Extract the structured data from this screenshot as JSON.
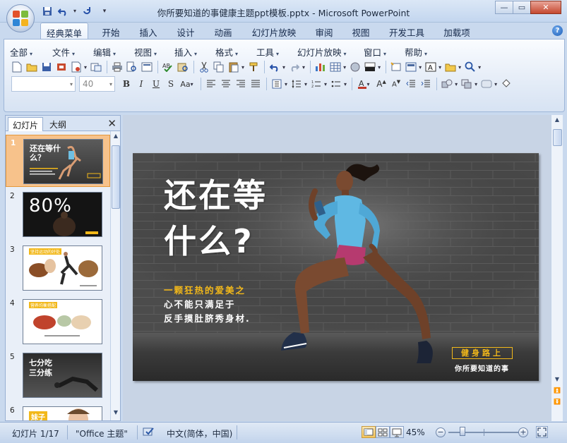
{
  "window": {
    "title": "你所要知道的事健康主题ppt模板.pptx - Microsoft PowerPoint"
  },
  "ribbon_tabs": [
    "经典菜单",
    "开始",
    "插入",
    "设计",
    "动画",
    "幻灯片放映",
    "审阅",
    "视图",
    "开发工具",
    "加载项"
  ],
  "classic_menu": [
    "全部",
    "文件",
    "编辑",
    "视图",
    "插入",
    "格式",
    "工具",
    "幻灯片放映",
    "窗口",
    "帮助"
  ],
  "font_size": "40",
  "panel": {
    "tabs": [
      "幻灯片",
      "大纲"
    ],
    "thumbnails": [
      {
        "number": "1",
        "text": "还在等什么？"
      },
      {
        "number": "2",
        "text": "80%"
      },
      {
        "number": "3",
        "text": "坚持运动的好处"
      },
      {
        "number": "4",
        "text": "营养均衡搭配"
      },
      {
        "number": "5",
        "text": "七分吃三分练"
      },
      {
        "number": "6",
        "text": "妹子"
      }
    ]
  },
  "slide": {
    "title_line1": "还在等",
    "title_line2": "什么?",
    "subtitle_line1": "一颗狂热的爱美之",
    "subtitle_line2": "心不能只满足于",
    "subtitle_line3": "反手摸肚脐秀身材.",
    "badge": "健身路上",
    "badge_sub": "你所要知道的事"
  },
  "status": {
    "slide_count": "幻灯片 1/17",
    "theme": "\"Office 主题\"",
    "language": "中文(简体，中国)",
    "zoom": "45%"
  },
  "colors": {
    "accent_yellow": "#f2b81a",
    "selection": "#f7c28b",
    "ribbon_blue": "#c9d9ee"
  }
}
